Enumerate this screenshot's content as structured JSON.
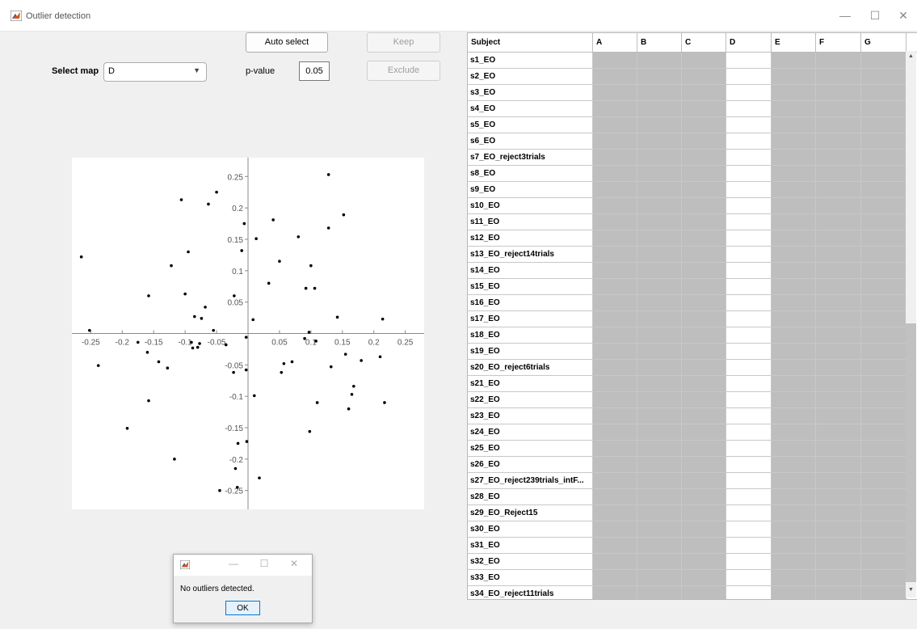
{
  "window": {
    "title": "Outlier detection",
    "minimize": "—",
    "maximize": "☐",
    "close": "✕"
  },
  "controls": {
    "auto_select_label": "Auto select",
    "keep_label": "Keep",
    "exclude_label": "Exclude",
    "select_map_label": "Select map",
    "select_map_value": "D",
    "pvalue_label": "p-value",
    "pvalue_value": "0.05"
  },
  "table": {
    "headers": [
      "Subject",
      "A",
      "B",
      "C",
      "D",
      "E",
      "F",
      "G"
    ],
    "highlighted_column": "D",
    "rows": [
      "s1_EO",
      "s2_EO",
      "s3_EO",
      "s4_EO",
      "s5_EO",
      "s6_EO",
      "s7_EO_reject3trials",
      "s8_EO",
      "s9_EO",
      "s10_EO",
      "s11_EO",
      "s12_EO",
      "s13_EO_reject14trials",
      "s14_EO",
      "s15_EO",
      "s16_EO",
      "s17_EO",
      "s18_EO",
      "s19_EO",
      "s20_EO_reject6trials",
      "s21_EO",
      "s22_EO",
      "s23_EO",
      "s24_EO",
      "s25_EO",
      "s26_EO",
      "s27_EO_reject239trials_intF...",
      "s28_EO",
      "s29_EO_Reject15",
      "s30_EO",
      "s31_EO",
      "s32_EO",
      "s33_EO",
      "s34_EO_reject11trials"
    ]
  },
  "dialog": {
    "message": "No outliers detected.",
    "ok_label": "OK",
    "minimize": "—",
    "maximize": "☐",
    "close": "✕"
  },
  "chart_data": {
    "type": "scatter",
    "xlim": [
      -0.28,
      0.28
    ],
    "ylim": [
      -0.28,
      0.28
    ],
    "xticks": [
      -0.25,
      -0.2,
      -0.15,
      -0.1,
      -0.05,
      0.05,
      0.1,
      0.15,
      0.2,
      0.25
    ],
    "yticks": [
      0.25,
      0.2,
      0.15,
      0.1,
      0.05,
      -0.05,
      -0.1,
      -0.15,
      -0.2,
      -0.25
    ],
    "xtick_labels": [
      "-0.25",
      "-0.2",
      "-0.15",
      "-0.1",
      "-0.05",
      "0.05",
      "0.1",
      "0.15",
      "0.2",
      "0.25"
    ],
    "ytick_labels": [
      "0.25",
      "0.2",
      "0.15",
      "0.1",
      "0.05",
      "-0.05",
      "-0.1",
      "-0.15",
      "-0.2",
      "-0.25"
    ],
    "points": [
      [
        0.128,
        0.253
      ],
      [
        0.152,
        0.189
      ],
      [
        0.128,
        0.168
      ],
      [
        0.04,
        0.181
      ],
      [
        0.08,
        0.154
      ],
      [
        0.013,
        0.151
      ],
      [
        -0.05,
        0.225
      ],
      [
        -0.063,
        0.206
      ],
      [
        -0.106,
        0.213
      ],
      [
        -0.006,
        0.175
      ],
      [
        -0.01,
        0.132
      ],
      [
        -0.095,
        0.13
      ],
      [
        -0.122,
        0.108
      ],
      [
        -0.265,
        0.122
      ],
      [
        0.05,
        0.115
      ],
      [
        0.1,
        0.108
      ],
      [
        0.033,
        0.08
      ],
      [
        0.092,
        0.072
      ],
      [
        0.106,
        0.072
      ],
      [
        -0.1,
        0.063
      ],
      [
        -0.158,
        0.06
      ],
      [
        -0.022,
        0.06
      ],
      [
        -0.068,
        0.042
      ],
      [
        -0.085,
        0.027
      ],
      [
        -0.074,
        0.024
      ],
      [
        0.142,
        0.026
      ],
      [
        0.214,
        0.023
      ],
      [
        0.008,
        0.022
      ],
      [
        -0.252,
        0.005
      ],
      [
        -0.055,
        0.005
      ],
      [
        -0.088,
        -0.023
      ],
      [
        -0.08,
        -0.022
      ],
      [
        -0.077,
        -0.016
      ],
      [
        -0.09,
        -0.014
      ],
      [
        -0.175,
        -0.014
      ],
      [
        -0.035,
        -0.018
      ],
      [
        0.097,
        0.002
      ],
      [
        -0.003,
        -0.006
      ],
      [
        0.09,
        -0.008
      ],
      [
        0.108,
        -0.012
      ],
      [
        -0.16,
        -0.03
      ],
      [
        0.155,
        -0.033
      ],
      [
        0.21,
        -0.037
      ],
      [
        0.18,
        -0.043
      ],
      [
        0.07,
        -0.045
      ],
      [
        0.057,
        -0.048
      ],
      [
        0.132,
        -0.053
      ],
      [
        -0.128,
        -0.055
      ],
      [
        -0.142,
        -0.045
      ],
      [
        -0.238,
        -0.051
      ],
      [
        -0.003,
        -0.058
      ],
      [
        -0.023,
        -0.062
      ],
      [
        0.053,
        -0.062
      ],
      [
        0.168,
        -0.084
      ],
      [
        0.165,
        -0.097
      ],
      [
        0.01,
        -0.099
      ],
      [
        -0.158,
        -0.107
      ],
      [
        0.11,
        -0.11
      ],
      [
        0.217,
        -0.11
      ],
      [
        0.16,
        -0.12
      ],
      [
        0.098,
        -0.156
      ],
      [
        -0.192,
        -0.151
      ],
      [
        -0.016,
        -0.175
      ],
      [
        -0.002,
        -0.172
      ],
      [
        -0.117,
        -0.2
      ],
      [
        -0.02,
        -0.215
      ],
      [
        0.018,
        -0.23
      ],
      [
        -0.017,
        -0.245
      ],
      [
        -0.045,
        -0.25
      ]
    ]
  }
}
